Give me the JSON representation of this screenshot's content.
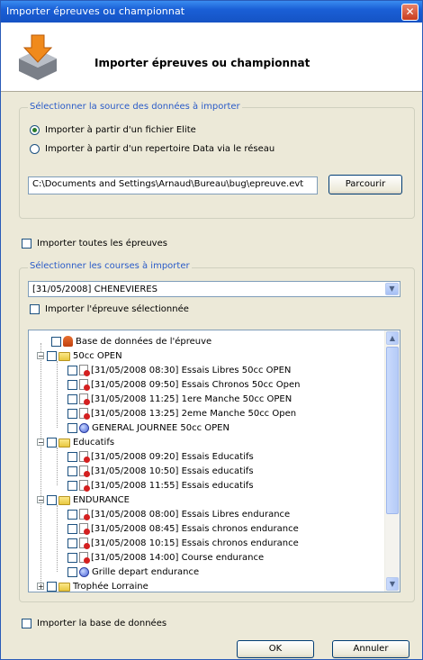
{
  "window": {
    "title": "Importer épreuves ou championnat",
    "close_glyph": "✕"
  },
  "header": {
    "title": "Importer épreuves ou championnat"
  },
  "source_group": {
    "legend": "Sélectionner la source des données à importer",
    "option_file": "Importer à partir d'un fichier Elite",
    "option_network": "Importer à partir d'un repertoire Data via le réseau",
    "selected": "option_file",
    "path_value": "C:\\Documents and Settings\\Arnaud\\Bureau\\bug\\epreuve.evt",
    "browse_label": "Parcourir"
  },
  "import_all_label": "Importer toutes les épreuves",
  "courses_group": {
    "legend": "Sélectionner les courses à importer",
    "event_selected": "[31/05/2008] CHENEVIERES",
    "import_selected_label": "Importer l'épreuve sélectionnée",
    "tree": {
      "db_node": "Base de données de l'épreuve",
      "cat1": {
        "label": "50cc OPEN",
        "items": [
          "[31/05/2008 08:30] Essais Libres 50cc OPEN",
          "[31/05/2008 09:50] Essais Chronos 50cc Open",
          "[31/05/2008 11:25] 1ere Manche 50cc OPEN",
          "[31/05/2008 13:25] 2eme Manche 50cc Open",
          "GENERAL JOURNEE 50cc OPEN"
        ]
      },
      "cat2": {
        "label": "Educatifs",
        "items": [
          "[31/05/2008 09:20] Essais Educatifs",
          "[31/05/2008 10:50] Essais educatifs",
          "[31/05/2008 11:55] Essais educatifs"
        ]
      },
      "cat3": {
        "label": "ENDURANCE",
        "items": [
          "[31/05/2008 08:00] Essais Libres endurance",
          "[31/05/2008 08:45] Essais chronos endurance",
          "[31/05/2008 10:15] Essais chronos endurance",
          "[31/05/2008 14:00] Course endurance",
          "Grille depart endurance"
        ]
      },
      "cat4": {
        "label": "Trophée Lorraine"
      }
    }
  },
  "import_db_label": "Importer la base de données",
  "buttons": {
    "ok": "OK",
    "cancel": "Annuler"
  },
  "glyphs": {
    "minus": "−",
    "plus": "+",
    "down": "▼",
    "up": "▲"
  }
}
